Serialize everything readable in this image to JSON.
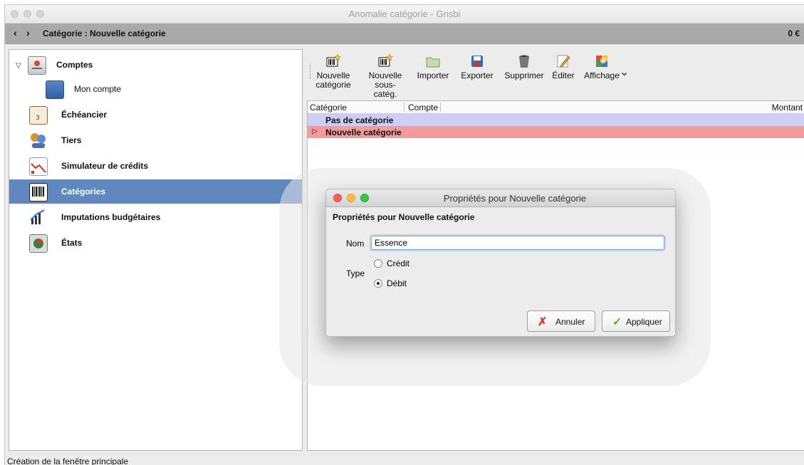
{
  "window": {
    "title": "Anomalie catégorie - Grisbi"
  },
  "nav": {
    "back": "‹",
    "forward": "›",
    "title": "Catégorie : Nouvelle catégorie",
    "balance": "0 €"
  },
  "sidebar": {
    "items": [
      {
        "label": "Comptes",
        "icon": "accounts-icon"
      },
      {
        "label": "Mon compte",
        "icon": "account-card-icon"
      },
      {
        "label": "Échéancier",
        "icon": "calendar-icon"
      },
      {
        "label": "Tiers",
        "icon": "people-icon"
      },
      {
        "label": "Simulateur de crédits",
        "icon": "chart-icon"
      },
      {
        "label": "Catégories",
        "icon": "barcode-icon",
        "selected": true
      },
      {
        "label": "Imputations budgétaires",
        "icon": "budget-chart-icon"
      },
      {
        "label": "États",
        "icon": "reports-icon"
      }
    ]
  },
  "toolbar": {
    "new_category": "Nouvelle\ncatégorie",
    "new_subcategory": "Nouvelle\nsous-catég.",
    "import": "Importer",
    "export": "Exporter",
    "delete": "Supprimer",
    "edit": "Éditer",
    "view": "Affichage",
    "more": "⌄"
  },
  "table": {
    "columns": [
      "Catégorie",
      "Compte",
      "Montant"
    ],
    "rows": [
      {
        "label": "Pas de catégorie",
        "color": "#cdcdf5"
      },
      {
        "label": "Nouvelle catégorie",
        "color": "#f39b9b"
      }
    ]
  },
  "dialog": {
    "title": "Propriétés pour Nouvelle catégorie",
    "heading": "Propriétés pour Nouvelle catégorie",
    "name_label": "Nom",
    "name_value": "Essence",
    "type_label": "Type",
    "options": [
      {
        "label": "Crédit",
        "checked": false
      },
      {
        "label": "Débit",
        "checked": true
      }
    ],
    "cancel_label": "Annuler",
    "apply_label": "Appliquer"
  },
  "status": {
    "text": "Création de la fenêtre principale"
  },
  "colors": {
    "selection": "#5f88c1",
    "header_bar": "#a9a9a9"
  }
}
